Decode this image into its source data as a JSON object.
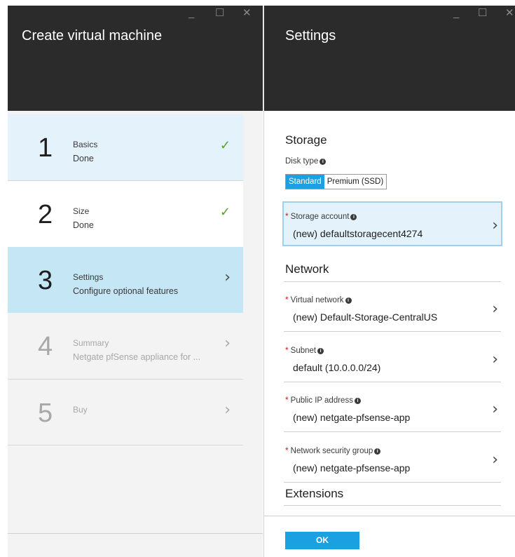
{
  "left_blade": {
    "title": "Create virtual machine",
    "controls": {
      "minimize": "_",
      "maximize": "☐",
      "close": "✕"
    },
    "steps": [
      {
        "number": "1",
        "label": "Basics",
        "sub": "Done",
        "state": "done"
      },
      {
        "number": "2",
        "label": "Size",
        "sub": "Done",
        "state": "done"
      },
      {
        "number": "3",
        "label": "Settings",
        "sub": "Configure optional features",
        "state": "active"
      },
      {
        "number": "4",
        "label": "Summary",
        "sub": "Netgate pfSense appliance for ...",
        "state": "disabled"
      },
      {
        "number": "5",
        "label": "Buy",
        "sub": "",
        "state": "disabled"
      }
    ]
  },
  "right_blade": {
    "title": "Settings",
    "controls": {
      "minimize": "_",
      "maximize": "☐",
      "close": "✕"
    },
    "storage": {
      "heading": "Storage",
      "disk_type_label": "Disk type",
      "disk_type_options": [
        "Standard",
        "Premium (SSD)"
      ],
      "selected": "Standard",
      "storage_account_label": "Storage account",
      "storage_account_value": "(new) defaultstoragecent4274"
    },
    "network": {
      "heading": "Network",
      "fields": [
        {
          "label": "Virtual network",
          "value": "(new) Default-Storage-CentralUS"
        },
        {
          "label": "Subnet",
          "value": "default (10.0.0.0/24)"
        },
        {
          "label": "Public IP address",
          "value": "(new) netgate-pfsense-app"
        },
        {
          "label": "Network security group",
          "value": "(new) netgate-pfsense-app"
        }
      ]
    },
    "extensions_heading": "Extensions",
    "ok_label": "OK"
  },
  "icons": {
    "check": "✓",
    "chevron": "›",
    "info": "i",
    "required": "*"
  },
  "colors": {
    "header_bg": "#2b2b2b",
    "accent": "#1ba1e2",
    "done_bg": "#e3f2fb",
    "active_bg": "#c5e6f5",
    "check": "#5ca12f"
  }
}
